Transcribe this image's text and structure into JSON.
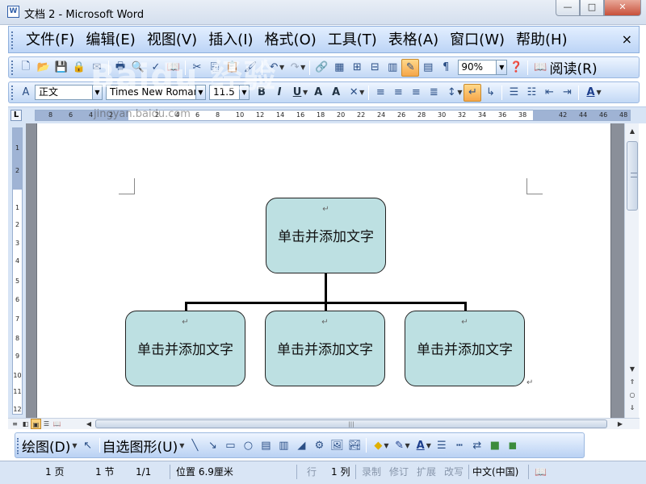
{
  "window": {
    "title": "文档 2 - Microsoft Word",
    "app_icon": "word-doc-icon",
    "minimize": "—",
    "maximize": "□",
    "close": "✕"
  },
  "menu": {
    "items": [
      "文件(F)",
      "编辑(E)",
      "视图(V)",
      "插入(I)",
      "格式(O)",
      "工具(T)",
      "表格(A)",
      "窗口(W)",
      "帮助(H)"
    ],
    "close_doc": "×"
  },
  "standard_toolbar": {
    "zoom": "90%",
    "read_label": "阅读(R)"
  },
  "formatting_toolbar": {
    "style": "正文",
    "font": "Times New Roman",
    "size": "11.5"
  },
  "ruler": {
    "numbers": [
      "8",
      "6",
      "4",
      "2",
      "2",
      "4",
      "6",
      "8",
      "10",
      "12",
      "14",
      "16",
      "18",
      "20",
      "22",
      "24",
      "26",
      "28",
      "30",
      "32",
      "34",
      "36",
      "38",
      "42",
      "44",
      "46",
      "48"
    ]
  },
  "vruler": {
    "numbers": [
      "1",
      "2",
      "1",
      "2",
      "3",
      "4",
      "5",
      "6",
      "7",
      "8",
      "9",
      "10",
      "11",
      "12",
      "13"
    ]
  },
  "org_chart": {
    "paragraph_mark": "↵",
    "top_box": {
      "text": "单击并添加文字"
    },
    "bottom_boxes": [
      {
        "text": "单击并添加文字"
      },
      {
        "text": "单击并添加文字"
      },
      {
        "text": "单击并添加文字"
      }
    ],
    "end_mark": "↵"
  },
  "drawing_toolbar": {
    "draw_label": "绘图(D)",
    "autoshapes_label": "自选图形(U)"
  },
  "status_bar": {
    "page": "1 页",
    "section": "1 节",
    "pages": "1/1",
    "position": "位置 6.9厘米",
    "line": "行",
    "column": "1 列",
    "record": "录制",
    "revise": "修订",
    "extend": "扩展",
    "overwrite": "改写",
    "language": "中文(中国)"
  },
  "watermark": {
    "brand": "Baidu 经验",
    "url": "jingyan.baidu.com"
  }
}
